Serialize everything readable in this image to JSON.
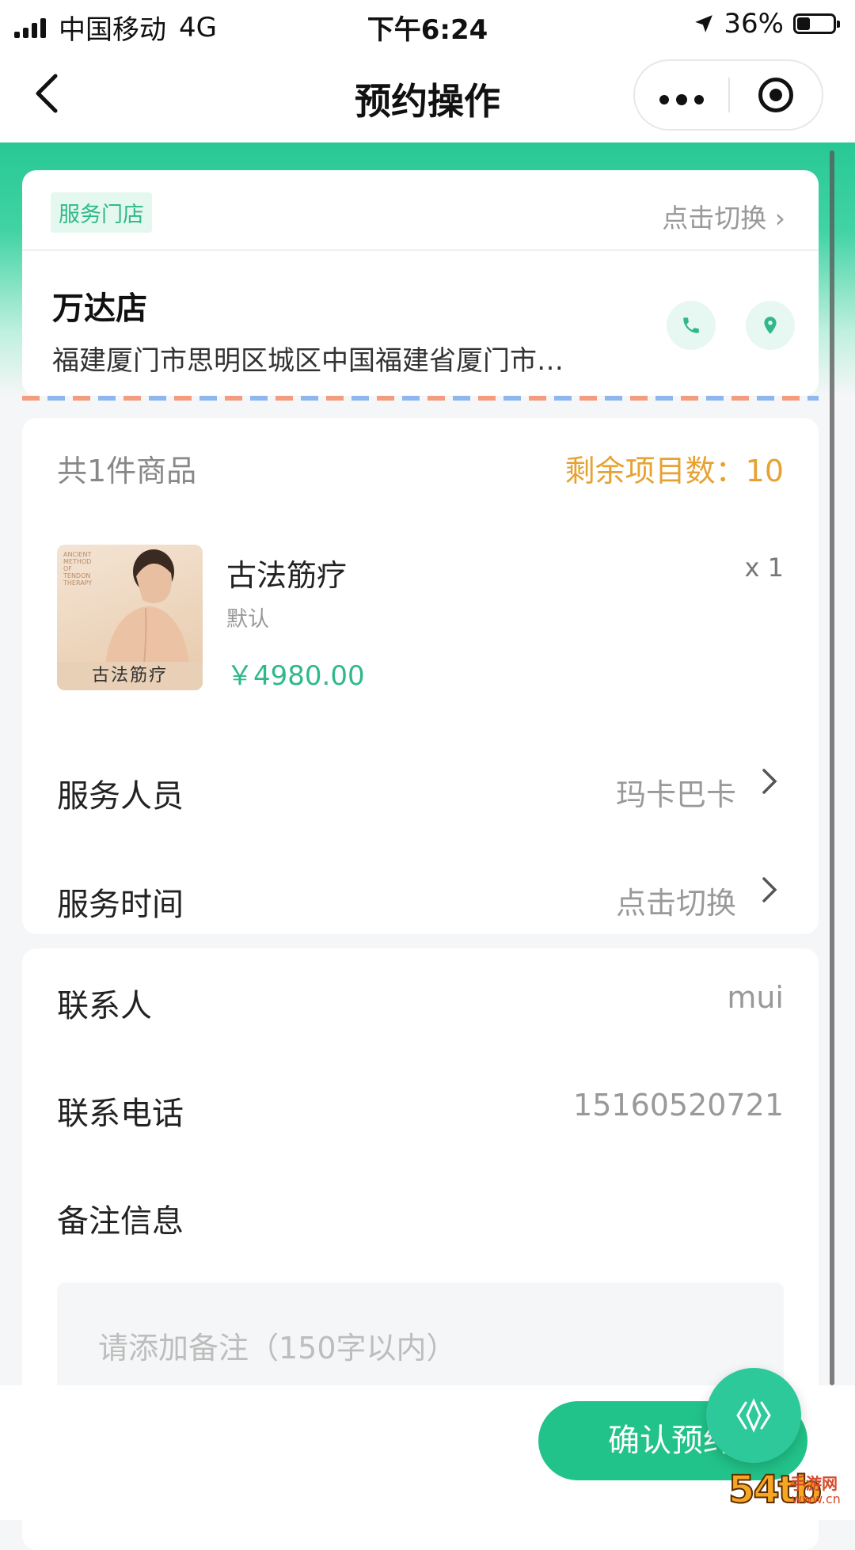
{
  "status_bar": {
    "carrier": "中国移动",
    "network": "4G",
    "time": "下午6:24",
    "battery": "36%",
    "battery_level": 0.36
  },
  "nav": {
    "title": "预约操作",
    "back_icon": "chevron-left-icon",
    "more_icon": "more-dots-icon",
    "close_icon": "target-icon"
  },
  "store": {
    "tag": "服务门店",
    "switch_label": "点击切换",
    "name": "万达店",
    "address": "福建厦门市思明区城区中国福建省厦门市…",
    "phone_icon": "phone-icon",
    "location_icon": "location-pin-icon"
  },
  "goods": {
    "count_label": "共1件商品",
    "remaining_label": "剩余项目数：",
    "remaining_value": "10",
    "items": [
      {
        "name": "古法筋疗",
        "spec": "默认",
        "price": "￥4980.00",
        "qty": "x 1",
        "image_caption": "古法筋疗",
        "image_text": "ANCIENT METHOD OF TENDON THERAPY"
      }
    ]
  },
  "service": {
    "staff_label": "服务人员",
    "staff_value": "玛卡巴卡",
    "time_label": "服务时间",
    "time_value": "点击切换"
  },
  "contact": {
    "name_label": "联系人",
    "name_value": "mui",
    "phone_label": "联系电话",
    "phone_value": "15160520721",
    "remark_label": "备注信息",
    "remark_placeholder": "请添加备注（150字以内）"
  },
  "actions": {
    "confirm_label": "确认预约",
    "float_icon": "brand-logo-icon"
  },
  "watermark": {
    "num": "54tb",
    "cn": "手游网",
    "url": "www.cn"
  },
  "colors": {
    "primary": "#22c38a",
    "accent_orange": "#e6a233",
    "price_green": "#2fb98a"
  }
}
